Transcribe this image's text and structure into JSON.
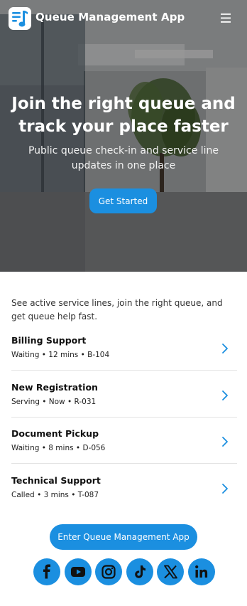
{
  "colors": {
    "accent": "#1b8fe0",
    "text": "#111111",
    "muted": "#333333",
    "divider": "#e3e3e3"
  },
  "header": {
    "app_title": "Queue Management App",
    "logo_icon": "queue-logo-icon",
    "menu_icon": "hamburger-menu-icon"
  },
  "hero": {
    "heading": "Join the right queue and track your place faster",
    "subheading": "Public queue check-in and service line updates in one place",
    "cta_label": "Get Started"
  },
  "intro": "See active service lines, join the right queue, and get queue help fast.",
  "queues": [
    {
      "name": "Billing Support",
      "meta": "Waiting • 12 mins • B-104"
    },
    {
      "name": "New Registration",
      "meta": "Serving • Now • R-031"
    },
    {
      "name": "Document Pickup",
      "meta": "Waiting • 8 mins • D-056"
    },
    {
      "name": "Technical Support",
      "meta": "Called • 3 mins • T-087"
    }
  ],
  "enter_button_label": "Enter Queue Management App",
  "socials": [
    "facebook-icon",
    "youtube-icon",
    "instagram-icon",
    "tiktok-icon",
    "x-icon",
    "linkedin-icon"
  ]
}
